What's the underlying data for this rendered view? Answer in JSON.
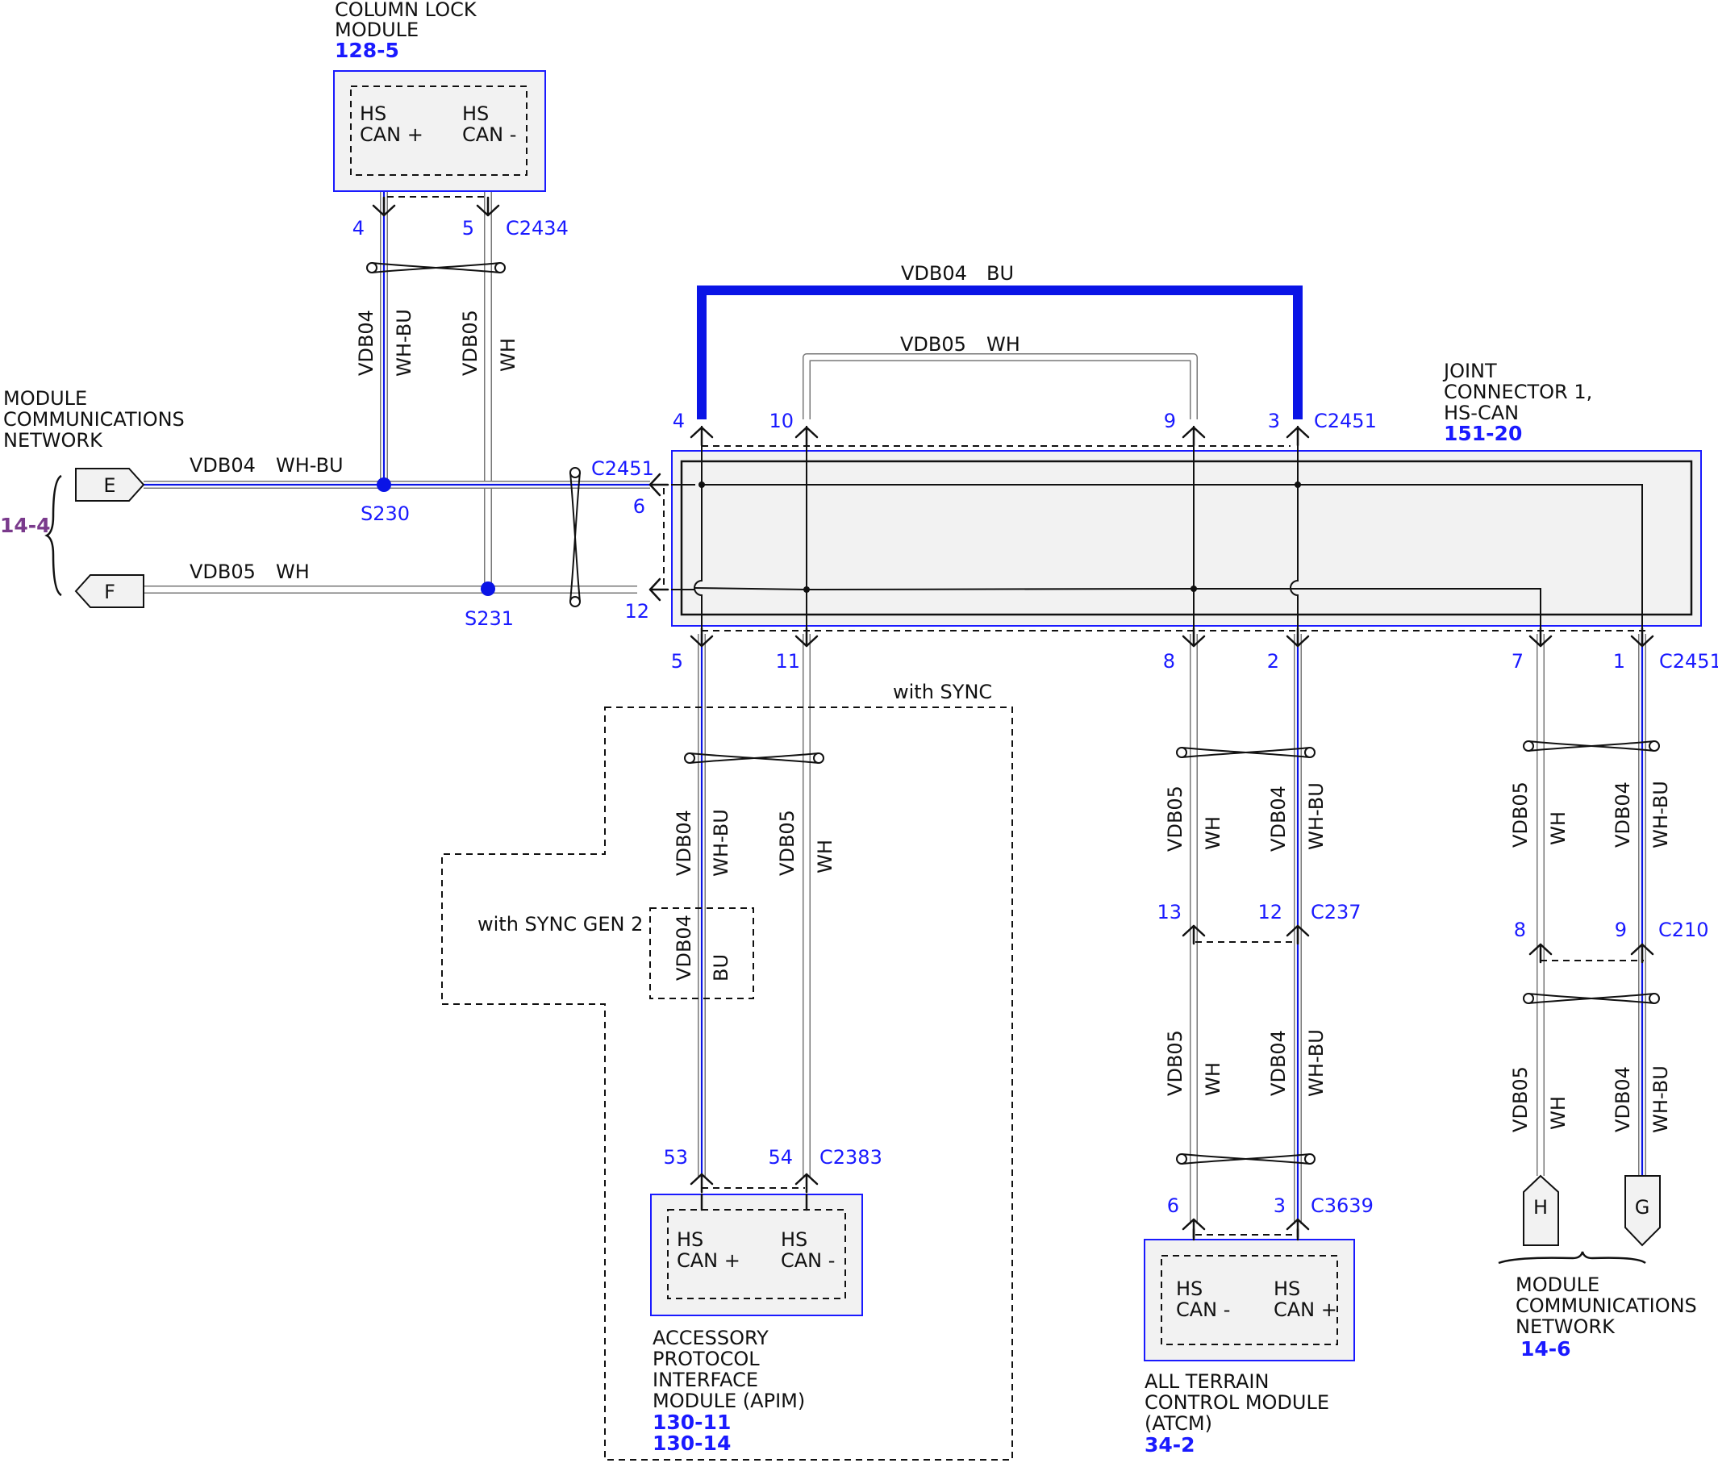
{
  "colors": {
    "wire_blue": "#0a14e6",
    "wire_white": "#ffffff",
    "wire_outline": "#777777",
    "module_border": "#1a1aff",
    "module_fill": "#f2f2f2",
    "pin_text": "#1a1aff",
    "ref_text": "#1a1aff",
    "ref_purple": "#7a3a8c",
    "text": "#111111"
  },
  "modules": {
    "column_lock": {
      "name_lines": [
        "COLUMN LOCK",
        "MODULE"
      ],
      "ref": "128-5",
      "pin_labels": {
        "plus": [
          "HS",
          "CAN +"
        ],
        "minus": [
          "HS",
          "CAN -"
        ]
      }
    },
    "joint": {
      "name_lines": [
        "JOINT",
        "CONNECTOR 1,",
        "HS-CAN"
      ],
      "ref": "151-20"
    },
    "apim": {
      "name_lines": [
        "ACCESSORY",
        "PROTOCOL",
        "INTERFACE",
        "MODULE (APIM)"
      ],
      "refs": [
        "130-11",
        "130-14"
      ],
      "pin_labels": {
        "plus": [
          "HS",
          "CAN +"
        ],
        "minus": [
          "HS",
          "CAN -"
        ]
      }
    },
    "atcm": {
      "name_lines": [
        "ALL TERRAIN",
        "CONTROL MODULE",
        "(ATCM)"
      ],
      "ref": "34-2",
      "pin_labels": {
        "minus": [
          "HS",
          "CAN -"
        ],
        "plus": [
          "HS",
          "CAN +"
        ]
      }
    },
    "mcn_left": {
      "name_lines": [
        "MODULE",
        "COMMUNICATIONS",
        "NETWORK"
      ],
      "ref": "14-4",
      "connectors": [
        "E",
        "F"
      ]
    },
    "mcn_right": {
      "name_lines": [
        "MODULE",
        "COMMUNICATIONS",
        "NETWORK"
      ],
      "ref": "14-6",
      "connectors": [
        "H",
        "G"
      ]
    }
  },
  "connectors": {
    "c2434": {
      "name": "C2434",
      "pins": [
        "4",
        "5"
      ]
    },
    "c2451_top": {
      "name": "C2451",
      "pins": [
        "4",
        "10",
        "9",
        "3"
      ]
    },
    "c2451_left": {
      "name": "C2451",
      "pins": [
        "6",
        "12"
      ]
    },
    "c2451_bottom": {
      "name": "C2451",
      "pins": [
        "5",
        "11",
        "8",
        "2",
        "7",
        "1"
      ]
    },
    "c2383": {
      "name": "C2383",
      "pins": [
        "53",
        "54"
      ]
    },
    "c237": {
      "name": "C237",
      "pins": [
        "13",
        "12"
      ]
    },
    "c3639": {
      "name": "C3639",
      "pins": [
        "6",
        "3"
      ]
    },
    "c210": {
      "name": "C210",
      "pins": [
        "8",
        "9"
      ]
    }
  },
  "splices": [
    "S230",
    "S231"
  ],
  "wires": {
    "circuit_04": "VDB04",
    "circuit_05": "VDB05",
    "color_04": "WH-BU",
    "color_05": "WH",
    "color_bu": "BU"
  },
  "options": {
    "with_sync": "with SYNC",
    "with_sync_gen2": "with SYNC GEN 2"
  }
}
